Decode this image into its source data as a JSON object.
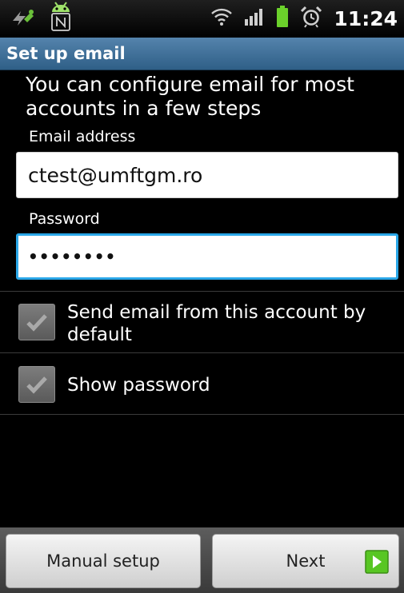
{
  "status_bar": {
    "time": "11:24",
    "icons": [
      "usb-debug-icon",
      "android-notification-icon",
      "wifi-icon",
      "signal-icon",
      "battery-icon",
      "alarm-icon"
    ]
  },
  "title_bar": {
    "title": "Set up email"
  },
  "form": {
    "intro": "You can configure email for most accounts in a few steps",
    "email": {
      "label": "Email address",
      "value": "ctest@umftgm.ro"
    },
    "password": {
      "label": "Password",
      "masked_value": "••••••••"
    },
    "checkboxes": [
      {
        "label": "Send email from this account by default",
        "checked": true
      },
      {
        "label": "Show password",
        "checked": true
      }
    ]
  },
  "buttons": {
    "manual_setup": "Manual setup",
    "next": "Next"
  },
  "colors": {
    "title_bar": "#3e6c95",
    "focus_border": "#2aa7e8",
    "next_arrow": "#58c623"
  }
}
